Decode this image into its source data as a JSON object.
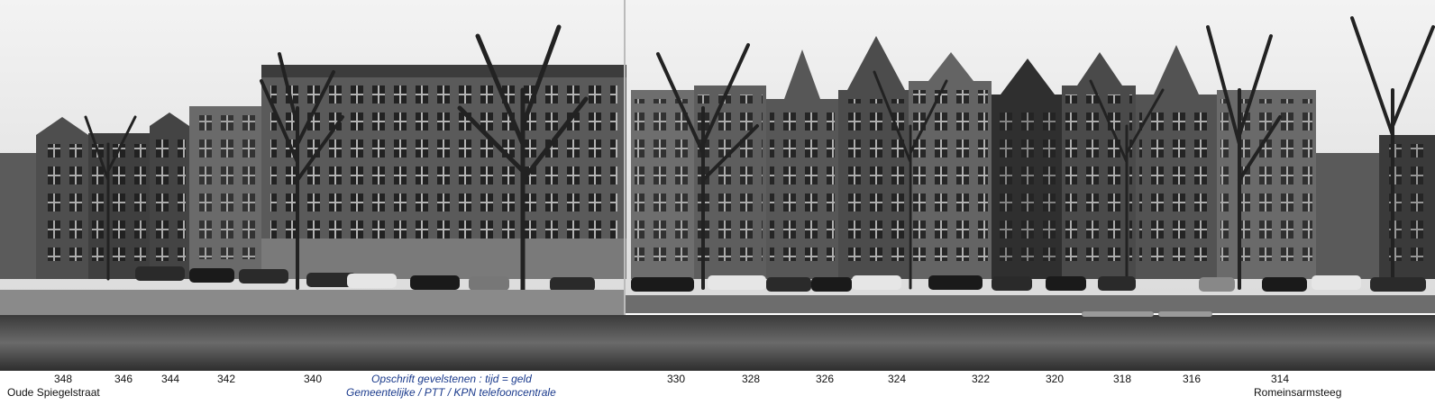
{
  "panorama": {
    "house_numbers": [
      "348",
      "346",
      "344",
      "342",
      "340",
      "330",
      "328",
      "326",
      "324",
      "322",
      "320",
      "318",
      "316",
      "314"
    ],
    "street_left": "Oude Spiegelstraat",
    "street_right": "Romeinsarmsteeg",
    "caption_line1": "Opschrift gevelstenen : tijd = geld",
    "caption_line2": "Gemeentelijke  / PTT / KPN  telefooncentrale",
    "caption_color": "#1a3a8c"
  }
}
